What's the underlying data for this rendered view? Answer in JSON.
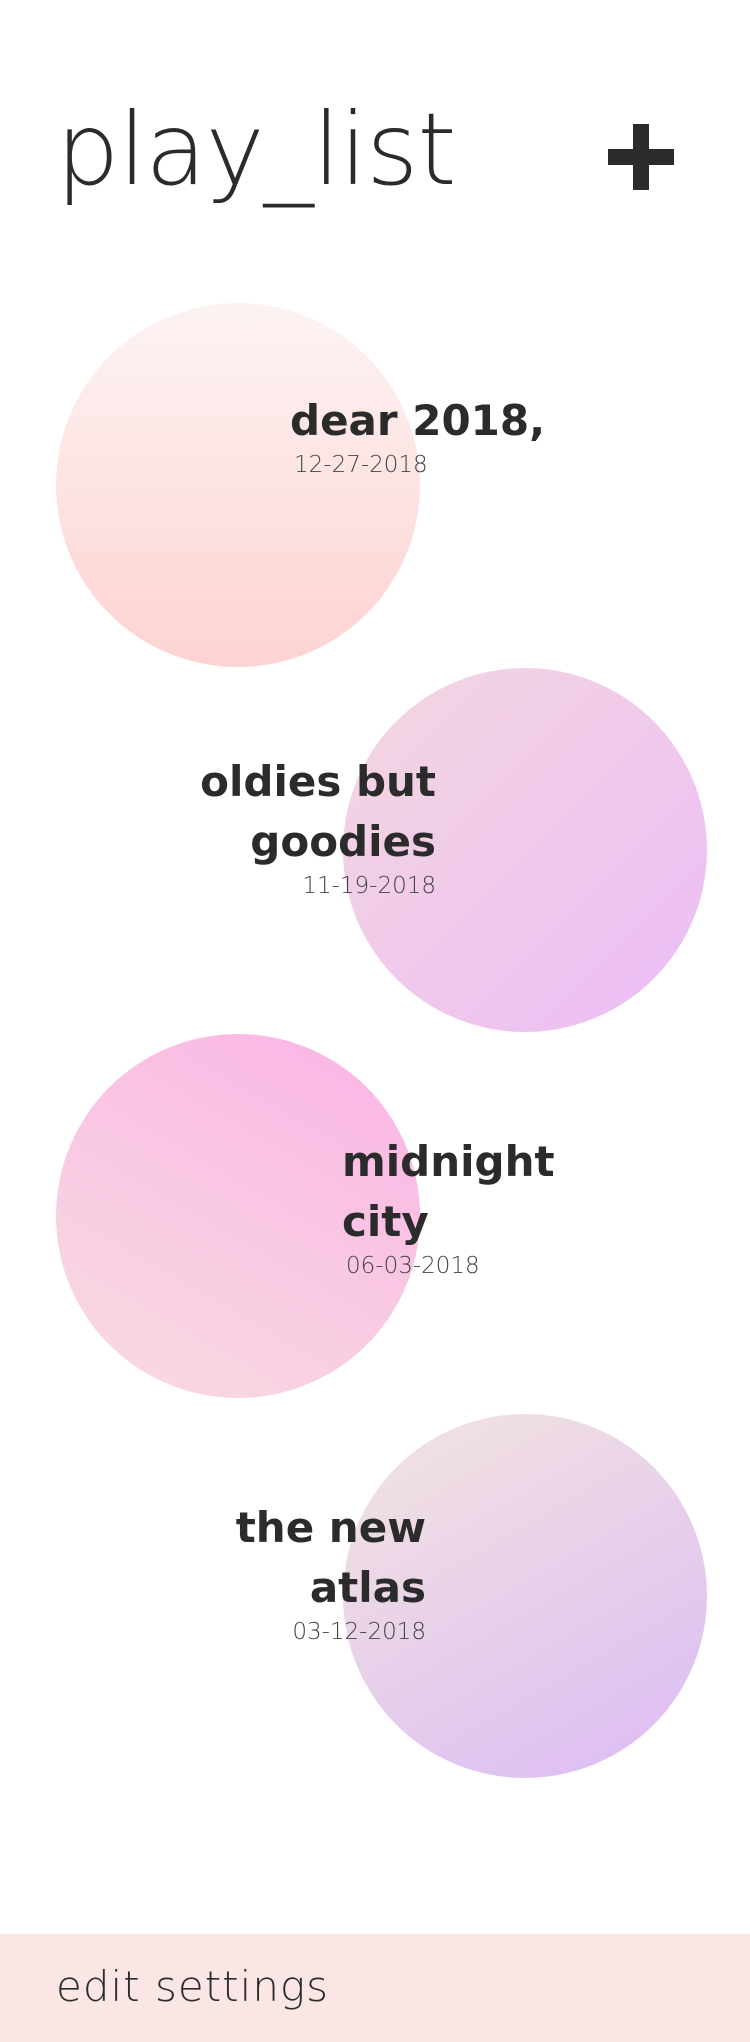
{
  "header": {
    "title": "play_list",
    "add_icon": "plus-icon"
  },
  "playlists": [
    {
      "name_lines": [
        "dear 2018,"
      ],
      "date": "12-27-2018",
      "gradient": [
        "#fdf3f3",
        "#fdd3d2"
      ]
    },
    {
      "name_lines": [
        "oldies but",
        "goodies"
      ],
      "date": "11-19-2018",
      "gradient": [
        "#f4d7df",
        "#ebbcf7"
      ]
    },
    {
      "name_lines": [
        "midnight",
        "city"
      ],
      "date": "06-03-2018",
      "gradient": [
        "#f7dde0",
        "#fbb3e6"
      ]
    },
    {
      "name_lines": [
        "the new",
        "atlas"
      ],
      "date": "03-12-2018",
      "gradient": [
        "#f3e5df",
        "#dbbbf5"
      ]
    }
  ],
  "footer": {
    "label": "edit settings",
    "background": "#f9e6e5"
  },
  "colors": {
    "text": "#2b2b2b",
    "background": "#ffffff"
  }
}
